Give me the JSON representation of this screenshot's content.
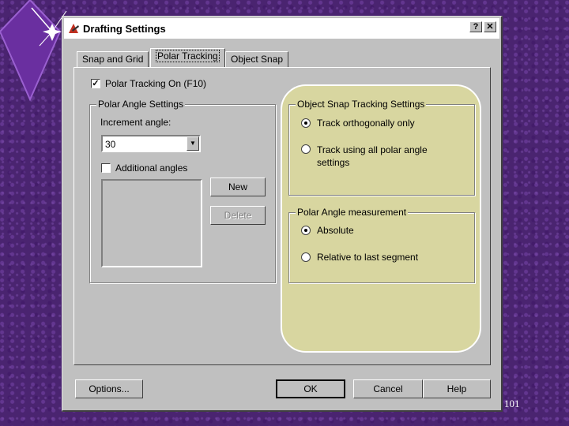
{
  "window": {
    "title": "Drafting Settings",
    "help_btn": "?",
    "close_btn": "✕"
  },
  "tabs": [
    {
      "label": "Snap and Grid",
      "active": false
    },
    {
      "label": "Polar Tracking",
      "active": true
    },
    {
      "label": "Object Snap",
      "active": false
    }
  ],
  "polar_tracking_on": {
    "label": "Polar Tracking On (F10)",
    "checked": true
  },
  "polar_angle_settings": {
    "title": "Polar Angle Settings",
    "increment_label": "Increment angle:",
    "increment_value": "30",
    "additional_angles": {
      "label": "Additional angles",
      "checked": false
    },
    "new_button": "New",
    "delete_button": "Delete"
  },
  "object_snap_tracking": {
    "title": "Object Snap Tracking Settings",
    "options": [
      {
        "label": "Track orthogonally only",
        "selected": true
      },
      {
        "label": "Track using all polar angle settings",
        "selected": false
      }
    ]
  },
  "polar_measurement": {
    "title": "Polar Angle measurement",
    "options": [
      {
        "label": "Absolute",
        "selected": true
      },
      {
        "label": "Relative to last segment",
        "selected": false
      }
    ]
  },
  "footer": {
    "options_button": "Options...",
    "ok_button": "OK",
    "cancel_button": "Cancel",
    "help_button": "Help"
  },
  "slide_number": "101",
  "colors": {
    "highlight": "#d8d6a0",
    "background": "#4a2470",
    "dialog": "#c0c0c0"
  }
}
